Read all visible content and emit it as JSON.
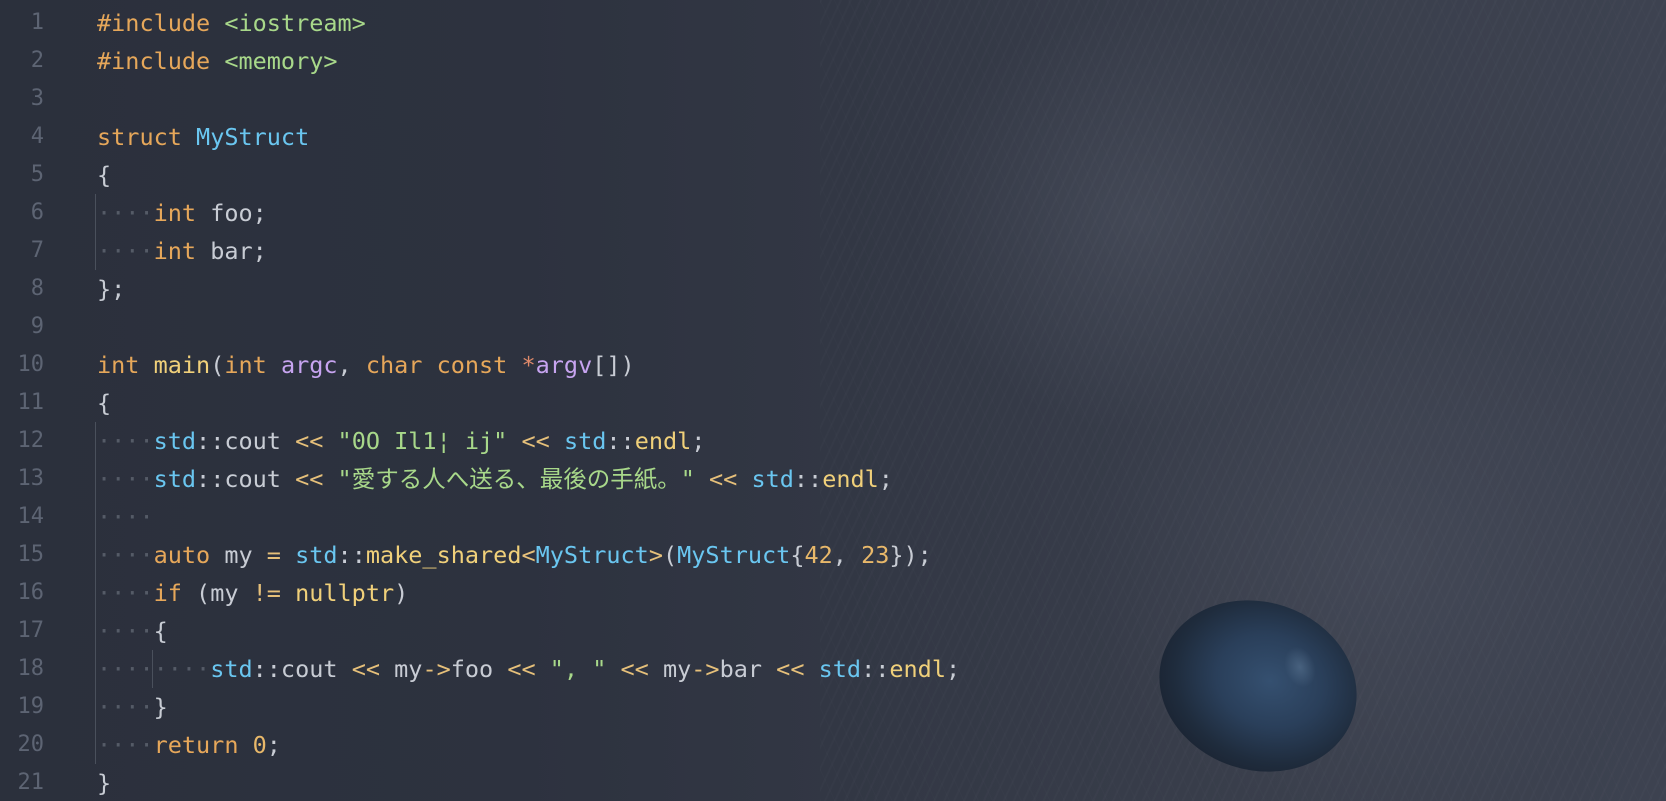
{
  "lines": [
    {
      "n": "1",
      "tokens": [
        [
          "orange",
          "#include "
        ],
        [
          "green",
          "<iostream>"
        ]
      ]
    },
    {
      "n": "2",
      "tokens": [
        [
          "orange",
          "#include "
        ],
        [
          "green",
          "<memory>"
        ]
      ]
    },
    {
      "n": "3",
      "tokens": []
    },
    {
      "n": "4",
      "tokens": [
        [
          "orange",
          "struct "
        ],
        [
          "blue",
          "MyStruct"
        ]
      ]
    },
    {
      "n": "5",
      "tokens": [
        [
          "plain",
          "{"
        ]
      ]
    },
    {
      "n": "6",
      "indent": 1,
      "tokens": [
        [
          "orange",
          "int "
        ],
        [
          "plain",
          "foo;"
        ]
      ]
    },
    {
      "n": "7",
      "indent": 1,
      "tokens": [
        [
          "orange",
          "int "
        ],
        [
          "plain",
          "bar;"
        ]
      ]
    },
    {
      "n": "8",
      "tokens": [
        [
          "plain",
          "};"
        ]
      ]
    },
    {
      "n": "9",
      "tokens": []
    },
    {
      "n": "10",
      "tokens": [
        [
          "orange",
          "int "
        ],
        [
          "yellow",
          "main"
        ],
        [
          "plain",
          "("
        ],
        [
          "orange",
          "int "
        ],
        [
          "purple",
          "argc"
        ],
        [
          "plain",
          ", "
        ],
        [
          "orange",
          "char const "
        ],
        [
          "red",
          "*"
        ],
        [
          "purple",
          "argv"
        ],
        [
          "plain",
          "[])"
        ]
      ]
    },
    {
      "n": "11",
      "tokens": [
        [
          "plain",
          "{"
        ]
      ]
    },
    {
      "n": "12",
      "indent": 1,
      "tokens": [
        [
          "blue",
          "std"
        ],
        [
          "plain",
          "::cout "
        ],
        [
          "op",
          "<< "
        ],
        [
          "green",
          "\"0O Il1¦ ij\""
        ],
        [
          "plain",
          " "
        ],
        [
          "op",
          "<< "
        ],
        [
          "blue",
          "std"
        ],
        [
          "plain",
          "::"
        ],
        [
          "yellow",
          "endl"
        ],
        [
          "plain",
          ";"
        ]
      ]
    },
    {
      "n": "13",
      "indent": 1,
      "tokens": [
        [
          "blue",
          "std"
        ],
        [
          "plain",
          "::cout "
        ],
        [
          "op",
          "<< "
        ],
        [
          "green",
          "\"愛する人へ送る、最後の手紙。\""
        ],
        [
          "plain",
          " "
        ],
        [
          "op",
          "<< "
        ],
        [
          "blue",
          "std"
        ],
        [
          "plain",
          "::"
        ],
        [
          "yellow",
          "endl"
        ],
        [
          "plain",
          ";"
        ]
      ]
    },
    {
      "n": "14",
      "indent": 1,
      "tokens": []
    },
    {
      "n": "15",
      "indent": 1,
      "tokens": [
        [
          "orange",
          "auto "
        ],
        [
          "plain",
          "my "
        ],
        [
          "op",
          "= "
        ],
        [
          "blue",
          "std"
        ],
        [
          "plain",
          "::"
        ],
        [
          "yellow",
          "make_shared"
        ],
        [
          "op",
          "<"
        ],
        [
          "blue",
          "MyStruct"
        ],
        [
          "op",
          ">"
        ],
        [
          "plain",
          "("
        ],
        [
          "blue",
          "MyStruct"
        ],
        [
          "plain",
          "{"
        ],
        [
          "num",
          "42"
        ],
        [
          "plain",
          ", "
        ],
        [
          "num",
          "23"
        ],
        [
          "plain",
          "});"
        ]
      ]
    },
    {
      "n": "16",
      "indent": 1,
      "tokens": [
        [
          "orange",
          "if "
        ],
        [
          "plain",
          "(my "
        ],
        [
          "op",
          "!= "
        ],
        [
          "yellow",
          "nullptr"
        ],
        [
          "plain",
          ")"
        ]
      ]
    },
    {
      "n": "17",
      "indent": 1,
      "tokens": [
        [
          "plain",
          "{"
        ]
      ]
    },
    {
      "n": "18",
      "indent": 2,
      "tokens": [
        [
          "blue",
          "std"
        ],
        [
          "plain",
          "::cout "
        ],
        [
          "op",
          "<< "
        ],
        [
          "plain",
          "my"
        ],
        [
          "op",
          "->"
        ],
        [
          "plain",
          "foo "
        ],
        [
          "op",
          "<< "
        ],
        [
          "green",
          "\", \""
        ],
        [
          "plain",
          " "
        ],
        [
          "op",
          "<< "
        ],
        [
          "plain",
          "my"
        ],
        [
          "op",
          "->"
        ],
        [
          "plain",
          "bar "
        ],
        [
          "op",
          "<< "
        ],
        [
          "blue",
          "std"
        ],
        [
          "plain",
          "::"
        ],
        [
          "yellow",
          "endl"
        ],
        [
          "plain",
          ";"
        ]
      ]
    },
    {
      "n": "19",
      "indent": 1,
      "tokens": [
        [
          "plain",
          "}"
        ]
      ]
    },
    {
      "n": "20",
      "indent": 1,
      "tokens": [
        [
          "orange",
          "return "
        ],
        [
          "num",
          "0"
        ],
        [
          "plain",
          ";"
        ]
      ]
    },
    {
      "n": "21",
      "tokens": [
        [
          "plain",
          "}"
        ]
      ]
    }
  ],
  "whitespace_marker": "····",
  "colors": {
    "background": "#2d3240",
    "line_number": "#5d6473",
    "keyword": "#e6a75a",
    "string": "#a8d88a",
    "type": "#6ac6f0",
    "variable": "#c7a4f0",
    "function": "#f0d07a",
    "plain": "#c8ccd4"
  }
}
